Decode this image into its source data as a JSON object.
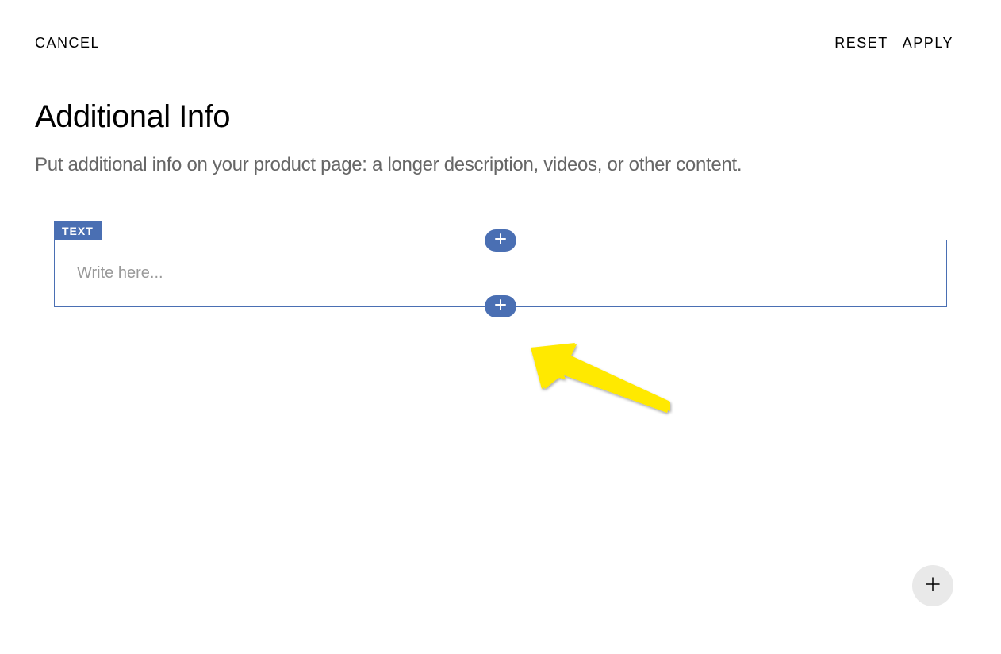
{
  "header": {
    "cancel_label": "CANCEL",
    "reset_label": "RESET",
    "apply_label": "APPLY"
  },
  "page": {
    "title": "Additional Info",
    "subtitle": "Put additional info on your product page: a longer description, videos, or other content."
  },
  "block": {
    "label": "TEXT",
    "placeholder": "Write here..."
  },
  "colors": {
    "accent": "#4a6fb3",
    "annotation": "#ffe900"
  }
}
